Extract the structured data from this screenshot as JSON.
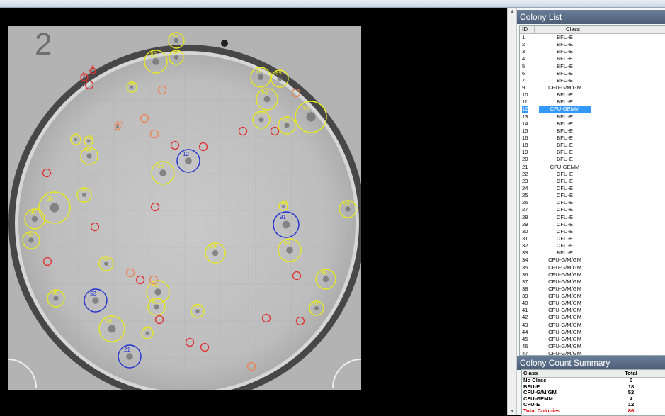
{
  "colony_list": {
    "title": "Colony List",
    "headers": {
      "id": "ID",
      "class": "Class"
    },
    "selected_id": "12",
    "rows": [
      {
        "id": "1",
        "cls": "BFU-E"
      },
      {
        "id": "2",
        "cls": "BFU-E"
      },
      {
        "id": "3",
        "cls": "BFU-E"
      },
      {
        "id": "4",
        "cls": "BFU-E"
      },
      {
        "id": "5",
        "cls": "BFU-E"
      },
      {
        "id": "6",
        "cls": "BFU-E"
      },
      {
        "id": "7",
        "cls": "BFU-E"
      },
      {
        "id": "9",
        "cls": "CFU-G/M/GM"
      },
      {
        "id": "10",
        "cls": "BFU-E"
      },
      {
        "id": "11",
        "cls": "BFU-E"
      },
      {
        "id": "12",
        "cls": "CFU-GEMM"
      },
      {
        "id": "13",
        "cls": "BFU-E"
      },
      {
        "id": "14",
        "cls": "BFU-E"
      },
      {
        "id": "15",
        "cls": "BFU-E"
      },
      {
        "id": "16",
        "cls": "BFU-E"
      },
      {
        "id": "18",
        "cls": "BFU-E"
      },
      {
        "id": "19",
        "cls": "BFU-E"
      },
      {
        "id": "20",
        "cls": "BFU-E"
      },
      {
        "id": "21",
        "cls": "CFU-GEMM"
      },
      {
        "id": "22",
        "cls": "CFU-E"
      },
      {
        "id": "23",
        "cls": "CFU-E"
      },
      {
        "id": "24",
        "cls": "CFU-E"
      },
      {
        "id": "25",
        "cls": "CFU-E"
      },
      {
        "id": "26",
        "cls": "CFU-E"
      },
      {
        "id": "27",
        "cls": "CFU-E"
      },
      {
        "id": "28",
        "cls": "CFU-E"
      },
      {
        "id": "29",
        "cls": "CFU-E"
      },
      {
        "id": "30",
        "cls": "CFU-E"
      },
      {
        "id": "31",
        "cls": "CFU-E"
      },
      {
        "id": "32",
        "cls": "CFU-E"
      },
      {
        "id": "33",
        "cls": "BFU-E"
      },
      {
        "id": "34",
        "cls": "CFU-G/M/GM"
      },
      {
        "id": "35",
        "cls": "CFU-G/M/GM"
      },
      {
        "id": "36",
        "cls": "CFU-G/M/GM"
      },
      {
        "id": "37",
        "cls": "CFU-G/M/GM"
      },
      {
        "id": "38",
        "cls": "CFU-G/M/GM"
      },
      {
        "id": "39",
        "cls": "CFU-G/M/GM"
      },
      {
        "id": "40",
        "cls": "CFU-G/M/GM"
      },
      {
        "id": "41",
        "cls": "CFU-G/M/GM"
      },
      {
        "id": "42",
        "cls": "CFU-G/M/GM"
      },
      {
        "id": "43",
        "cls": "CFU-G/M/GM"
      },
      {
        "id": "44",
        "cls": "CFU-G/M/GM"
      },
      {
        "id": "45",
        "cls": "CFU-G/M/GM"
      },
      {
        "id": "46",
        "cls": "CFU-G/M/GM"
      },
      {
        "id": "47",
        "cls": "CFU-G/M/GM"
      }
    ]
  },
  "summary": {
    "title": "Colony Count Summary",
    "headers": {
      "class": "Class",
      "total": "Total"
    },
    "rows": [
      {
        "label": "No Class",
        "value": "0"
      },
      {
        "label": "BFU-E",
        "value": "18"
      },
      {
        "label": "CFU-G/M/GM",
        "value": "52"
      },
      {
        "label": "CFU-GEMM",
        "value": "4"
      },
      {
        "label": "CFU-E",
        "value": "12"
      }
    ],
    "total_label": "Total Colonies",
    "total_value": "86"
  },
  "plate": {
    "grid_digit": "2",
    "colors": {
      "bfu_e": "#e03030",
      "cfu_gm": "#e8e820",
      "cfu_gemm": "#2030d0",
      "cfu_e": "#f08050"
    },
    "markers": [
      {
        "id": "52",
        "cls": "cfu_gm",
        "label": "52"
      },
      {
        "id": "82",
        "cls": "cfu_gm",
        "label": "82"
      },
      {
        "id": "84",
        "cls": "cfu_gm",
        "label": "84"
      },
      {
        "id": "5",
        "cls": "bfu_e",
        "label": "5"
      },
      {
        "id": "6",
        "cls": "bfu_e",
        "label": "6"
      },
      {
        "id": "19",
        "cls": "cfu_gm",
        "label": "19"
      },
      {
        "id": "28",
        "cls": "cfu_e",
        "label": "28"
      },
      {
        "id": "20",
        "cls": "cfu_gm",
        "label": "20"
      },
      {
        "id": "85",
        "cls": "cfu_gm",
        "label": "85"
      },
      {
        "id": "69",
        "cls": "cfu_gm",
        "label": "69"
      },
      {
        "id": "73",
        "cls": "cfu_gm",
        "label": "73"
      },
      {
        "id": "72",
        "cls": "cfu_gm",
        "label": "72"
      },
      {
        "id": "68",
        "cls": "cfu_gm",
        "label": "68"
      },
      {
        "id": "12",
        "cls": "cfu_gemm",
        "label": "12"
      },
      {
        "id": "23",
        "cls": "cfu_gm",
        "label": "23"
      },
      {
        "id": "44",
        "cls": "cfu_gm",
        "label": "44"
      },
      {
        "id": "15",
        "cls": "cfu_gm",
        "label": "15"
      },
      {
        "id": "46",
        "cls": "cfu_gm",
        "label": "46"
      },
      {
        "id": "36",
        "cls": "cfu_gm",
        "label": "36"
      },
      {
        "id": "30",
        "cls": "cfu_gm",
        "label": "30"
      },
      {
        "id": "40",
        "cls": "cfu_gm",
        "label": "40"
      },
      {
        "id": "43",
        "cls": "cfu_gm",
        "label": "43"
      },
      {
        "id": "49",
        "cls": "cfu_gm",
        "label": "49"
      },
      {
        "id": "57",
        "cls": "cfu_gm",
        "label": "57"
      },
      {
        "id": "65",
        "cls": "cfu_gm",
        "label": "65"
      },
      {
        "id": "58",
        "cls": "cfu_gm",
        "label": "58"
      },
      {
        "id": "91",
        "cls": "cfu_gemm",
        "label": "91"
      },
      {
        "id": "53",
        "cls": "cfu_gemm",
        "label": "53"
      },
      {
        "id": "21",
        "cls": "cfu_gemm",
        "label": "21"
      },
      {
        "id": "66",
        "cls": "cfu_gm",
        "label": "66"
      },
      {
        "id": "62",
        "cls": "cfu_gm",
        "label": "62"
      },
      {
        "id": "87",
        "cls": "cfu_gm",
        "label": "87"
      },
      {
        "id": "47",
        "cls": "cfu_gm",
        "label": "47"
      },
      {
        "id": "37",
        "cls": "cfu_gm",
        "label": "37"
      },
      {
        "id": "64",
        "cls": "cfu_gm",
        "label": "64"
      },
      {
        "id": "86",
        "cls": "cfu_gm",
        "label": "86"
      },
      {
        "id": "33",
        "cls": "cfu_gm",
        "label": "33"
      },
      {
        "id": "60",
        "cls": "cfu_gm",
        "label": "60"
      }
    ]
  }
}
